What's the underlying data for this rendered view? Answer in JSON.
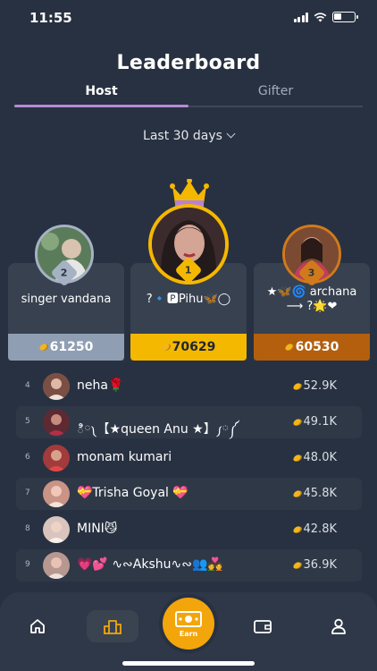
{
  "status": {
    "time": "11:55"
  },
  "header": {
    "title": "Leaderboard",
    "tabs": [
      {
        "label": "Host",
        "active": true
      },
      {
        "label": "Gifter",
        "active": false
      }
    ]
  },
  "filter": {
    "period": "Last 30 days"
  },
  "podium": [
    {
      "rank": "2",
      "name": "singer vandana",
      "score": "61250",
      "color": "#8f9eb3"
    },
    {
      "rank": "1",
      "name": "?🔹🅿Pihu🦋◯",
      "score": "70629",
      "color": "#f5b800"
    },
    {
      "rank": "3",
      "name": "★🦋🌀 archana",
      "name2": "⟶ ?🌟❤",
      "score": "60530",
      "color": "#b35f0e"
    }
  ],
  "list": [
    {
      "rank": "4",
      "name": "neha🌹",
      "score": "52.9K"
    },
    {
      "rank": "5",
      "name": "ి༾【★queen Anu ★】༿༼",
      "score": "49.1K"
    },
    {
      "rank": "6",
      "name": "monam kumari",
      "score": "48.0K"
    },
    {
      "rank": "7",
      "name": "💝Trisha Goyal 💝",
      "score": "45.8K"
    },
    {
      "rank": "8",
      "name": "MINI😼",
      "score": "42.8K"
    },
    {
      "rank": "9",
      "name": "💗💕 ∿∾Akshu∿∾👥💑",
      "score": "36.9K"
    }
  ],
  "nav": {
    "items": [
      "home-icon",
      "leaderboard-icon",
      "earn-icon",
      "wallet-icon",
      "profile-icon"
    ],
    "earn_label": "Earn",
    "accent": "#f2a60c"
  }
}
